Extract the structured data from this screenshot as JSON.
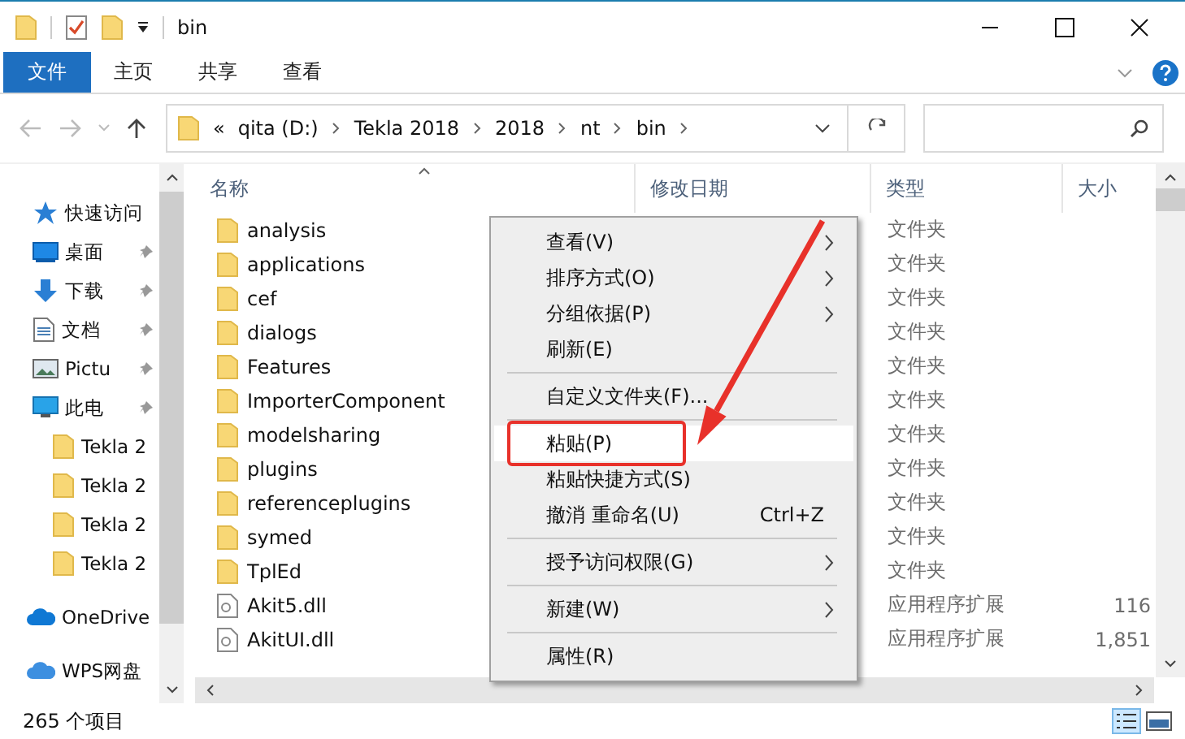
{
  "window": {
    "title": "bin"
  },
  "ribbon": {
    "tabs": [
      {
        "label": "文件",
        "selected": true
      },
      {
        "label": "主页",
        "selected": false
      },
      {
        "label": "共享",
        "selected": false
      },
      {
        "label": "查看",
        "selected": false
      }
    ]
  },
  "address_bar": {
    "overflow": "«",
    "crumbs": [
      "qita (D:)",
      "Tekla 2018",
      "2018",
      "nt",
      "bin"
    ]
  },
  "nav_pane": {
    "items": [
      {
        "label": "快速访问",
        "kind": "star",
        "pinned": false
      },
      {
        "label": "桌面",
        "kind": "desktop",
        "pinned": true
      },
      {
        "label": "下载",
        "kind": "download",
        "pinned": true
      },
      {
        "label": "文档",
        "kind": "document",
        "pinned": true
      },
      {
        "label": "Pictu",
        "kind": "pictures",
        "pinned": true
      },
      {
        "label": "此电",
        "kind": "computer",
        "pinned": true
      },
      {
        "label": "Tekla 2",
        "kind": "folder",
        "pinned": false
      },
      {
        "label": "Tekla 2",
        "kind": "folder",
        "pinned": false
      },
      {
        "label": "Tekla 2",
        "kind": "folder",
        "pinned": false
      },
      {
        "label": "Tekla 2",
        "kind": "folder",
        "pinned": false
      },
      {
        "label": "OneDrive",
        "kind": "onedrive",
        "pinned": false
      },
      {
        "label": "WPS网盘",
        "kind": "wps",
        "pinned": false
      }
    ]
  },
  "file_list": {
    "columns": [
      "名称",
      "修改日期",
      "类型",
      "大小"
    ],
    "rows": [
      {
        "name": "analysis",
        "kind": "folder",
        "type": "文件夹"
      },
      {
        "name": "applications",
        "kind": "folder",
        "type": "文件夹"
      },
      {
        "name": "cef",
        "kind": "folder",
        "type": "文件夹"
      },
      {
        "name": "dialogs",
        "kind": "folder",
        "type": "文件夹"
      },
      {
        "name": "Features",
        "kind": "folder",
        "type": "文件夹"
      },
      {
        "name": "ImporterComponent",
        "kind": "folder",
        "type": "文件夹"
      },
      {
        "name": "modelsharing",
        "kind": "folder",
        "type": "文件夹"
      },
      {
        "name": "plugins",
        "kind": "folder",
        "type": "文件夹"
      },
      {
        "name": "referenceplugins",
        "kind": "folder",
        "type": "文件夹"
      },
      {
        "name": "symed",
        "kind": "folder",
        "type": "文件夹"
      },
      {
        "name": "TplEd",
        "kind": "folder",
        "type": "文件夹"
      },
      {
        "name": "Akit5.dll",
        "kind": "dll",
        "type": "应用程序扩展",
        "size": "116"
      },
      {
        "name": "AkitUI.dll",
        "kind": "dll",
        "type": "应用程序扩展",
        "size": "1,851"
      }
    ]
  },
  "context_menu": {
    "items": [
      {
        "kind": "item",
        "label": "查看(V)",
        "submenu": true,
        "highlighted": false
      },
      {
        "kind": "item",
        "label": "排序方式(O)",
        "submenu": true,
        "highlighted": false
      },
      {
        "kind": "item",
        "label": "分组依据(P)",
        "submenu": true,
        "highlighted": false
      },
      {
        "kind": "item",
        "label": "刷新(E)",
        "submenu": false,
        "highlighted": false
      },
      {
        "kind": "separator"
      },
      {
        "kind": "item",
        "label": "自定义文件夹(F)...",
        "submenu": false,
        "highlighted": false
      },
      {
        "kind": "separator"
      },
      {
        "kind": "item",
        "label": "粘贴(P)",
        "submenu": false,
        "highlighted": true,
        "annotated": true
      },
      {
        "kind": "item",
        "label": "粘贴快捷方式(S)",
        "submenu": false,
        "highlighted": false
      },
      {
        "kind": "item",
        "label": "撤消 重命名(U)",
        "shortcut": "Ctrl+Z",
        "submenu": false,
        "highlighted": false
      },
      {
        "kind": "separator"
      },
      {
        "kind": "item",
        "label": "授予访问权限(G)",
        "submenu": true,
        "highlighted": false
      },
      {
        "kind": "separator"
      },
      {
        "kind": "item",
        "label": "新建(W)",
        "submenu": true,
        "highlighted": false
      },
      {
        "kind": "separator"
      },
      {
        "kind": "item",
        "label": "属性(R)",
        "submenu": false,
        "highlighted": false
      }
    ]
  },
  "status_bar": {
    "count": "265 个项目"
  }
}
